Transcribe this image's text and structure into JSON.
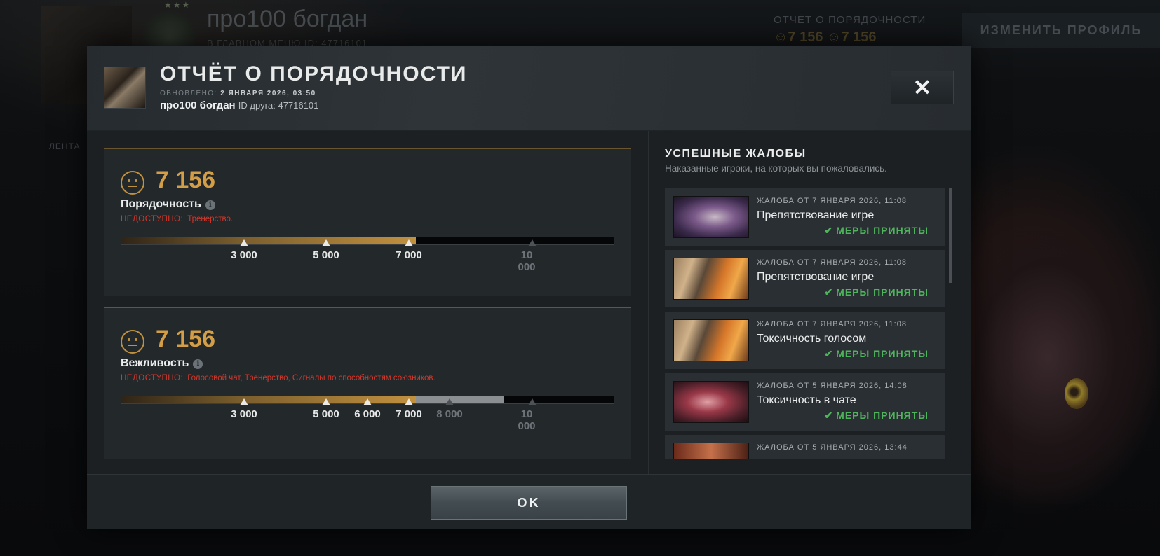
{
  "background": {
    "player_name": "про100 богдан",
    "subtitle": "В ГЛАВНОМ МЕНЮ  ID: 47716101",
    "side_label": "ЛЕНТА",
    "report_label": "ОТЧЁТ О ПОРЯДОЧНОСТИ",
    "report_values": "☺7 156  ☺7 156",
    "edit_profile_label": "ИЗМЕНИТЬ ПРОФИЛЬ",
    "stars": "★★★"
  },
  "modal": {
    "title": "ОТЧЁТ О ПОРЯДОЧНОСТИ",
    "updated_label": "ОБНОВЛЕНО:",
    "updated_value": "2 ЯНВАРЯ 2026, 03:50",
    "player_name": "про100 богдан",
    "friend_id": "ID друга: 47716101",
    "close_label": "✕",
    "ok_label": "OK"
  },
  "metrics": [
    {
      "score": "7 156",
      "label": "Порядочность",
      "unavailable_label": "НЕДОСТУПНО:",
      "unavailable_text": "Тренерство.",
      "value": 7156,
      "max": 12000,
      "future_until": null,
      "ticks": [
        {
          "value": 3000,
          "label": "3 000",
          "reached": true
        },
        {
          "value": 5000,
          "label": "5 000",
          "reached": true
        },
        {
          "value": 7000,
          "label": "7 000",
          "reached": true
        },
        {
          "value": 10000,
          "label": "10 000",
          "reached": false
        }
      ]
    },
    {
      "score": "7 156",
      "label": "Вежливость",
      "unavailable_label": "НЕДОСТУПНО:",
      "unavailable_text": "Голосовой чат, Тренерство, Сигналы по способностям союзников.",
      "value": 7156,
      "max": 12000,
      "future_until": 9300,
      "ticks": [
        {
          "value": 3000,
          "label": "3 000",
          "reached": true
        },
        {
          "value": 5000,
          "label": "5 000",
          "reached": true
        },
        {
          "value": 6000,
          "label": "6 000",
          "reached": true
        },
        {
          "value": 7000,
          "label": "7 000",
          "reached": true
        },
        {
          "value": 8000,
          "label": "8 000",
          "reached": false
        },
        {
          "value": 10000,
          "label": "10 000",
          "reached": false
        }
      ]
    }
  ],
  "reports_section": {
    "title": "УСПЕШНЫЕ ЖАЛОБЫ",
    "subtitle": "Наказанные игроки, на которых вы пожаловались.",
    "items": [
      {
        "date": "ЖАЛОБА ОТ 7 ЯНВАРЯ 2026, 11:08",
        "reason": "Препятствование игре",
        "status": "МЕРЫ ПРИНЯТЫ",
        "hero_icon": "hero-portrait-1"
      },
      {
        "date": "ЖАЛОБА ОТ 7 ЯНВАРЯ 2026, 11:08",
        "reason": "Препятствование игре",
        "status": "МЕРЫ ПРИНЯТЫ",
        "hero_icon": "hero-portrait-2"
      },
      {
        "date": "ЖАЛОБА ОТ 7 ЯНВАРЯ 2026, 11:08",
        "reason": "Токсичность голосом",
        "status": "МЕРЫ ПРИНЯТЫ",
        "hero_icon": "hero-portrait-2"
      },
      {
        "date": "ЖАЛОБА ОТ 5 ЯНВАРЯ 2026, 14:08",
        "reason": "Токсичность в чате",
        "status": "МЕРЫ ПРИНЯТЫ",
        "hero_icon": "hero-portrait-3"
      },
      {
        "date": "ЖАЛОБА ОТ 5 ЯНВАРЯ 2026, 13:44",
        "reason": "",
        "status": "",
        "hero_icon": "hero-portrait-4"
      }
    ]
  },
  "colors": {
    "accent_gold": "#d39e46",
    "status_green": "#4fb55c",
    "unavailable_red": "#d3372b"
  }
}
